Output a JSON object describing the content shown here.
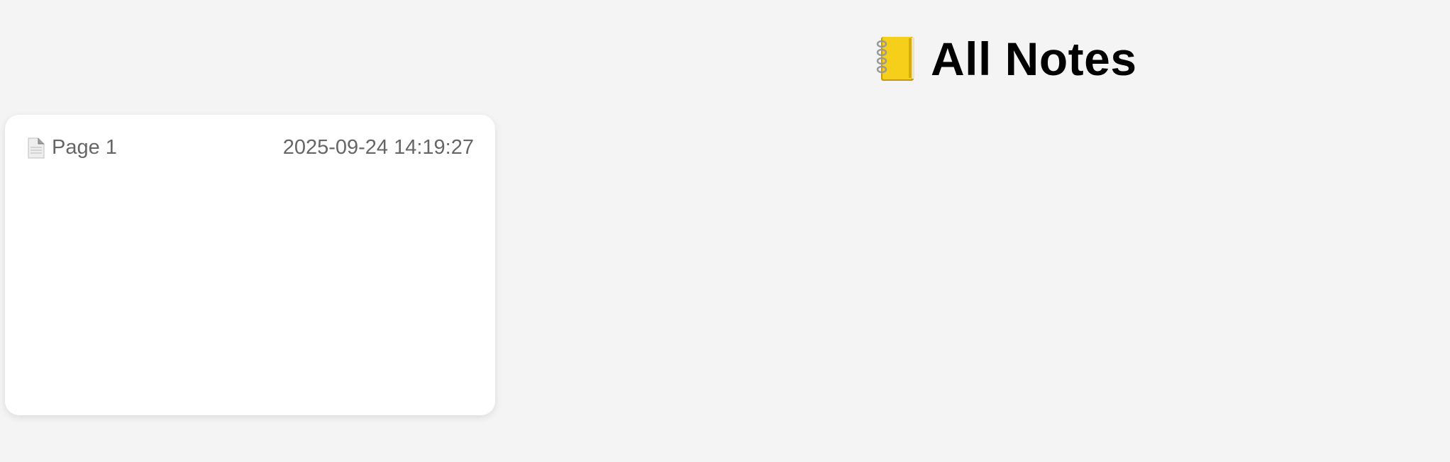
{
  "header": {
    "icon": "notebook-icon",
    "title": "All Notes"
  },
  "notes": [
    {
      "icon": "page-icon",
      "title": "Page 1",
      "timestamp": "2025-09-24 14:19:27"
    }
  ],
  "colors": {
    "background": "#f4f4f4",
    "card": "#ffffff",
    "muted_text": "#666666",
    "notebook_yellow": "#f5cf1a"
  }
}
